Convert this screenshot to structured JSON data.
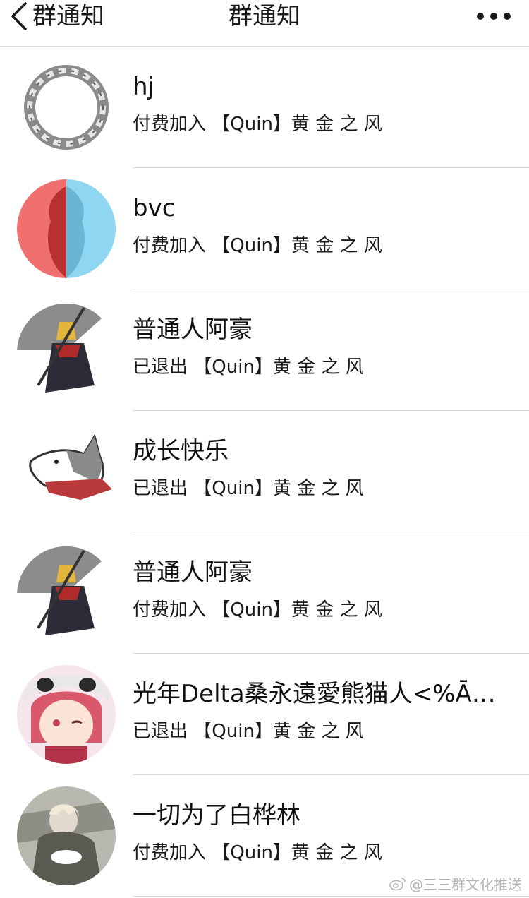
{
  "navbar": {
    "back_label": "群通知",
    "title": "群通知"
  },
  "items": [
    {
      "name": "hj",
      "action": "付费加入",
      "group": "【Quin】黄 金 之 风"
    },
    {
      "name": "bvc",
      "action": "付费加入",
      "group": "【Quin】黄 金 之 风"
    },
    {
      "name": "普通人阿豪",
      "action": "已退出",
      "group": "【Quin】黄 金 之 风"
    },
    {
      "name": "成长快乐",
      "action": "已退出",
      "group": "【Quin】黄 金 之 风"
    },
    {
      "name": "普通人阿豪",
      "action": "付费加入",
      "group": "【Quin】黄 金 之 风"
    },
    {
      "name": "光年Delta桑永遠愛熊猫人<%Ā…",
      "action": "已退出",
      "group": "【Quin】黄 金 之 风"
    },
    {
      "name": "一切为了白桦林",
      "action": "付费加入",
      "group": "【Quin】黄 金 之 风"
    }
  ],
  "watermark": {
    "text": "@三三群文化推送"
  },
  "colors": {
    "divider": "#dedede",
    "text": "#1a1a1a",
    "avatar_red": "#f07070",
    "avatar_blue": "#8fd6f2"
  }
}
